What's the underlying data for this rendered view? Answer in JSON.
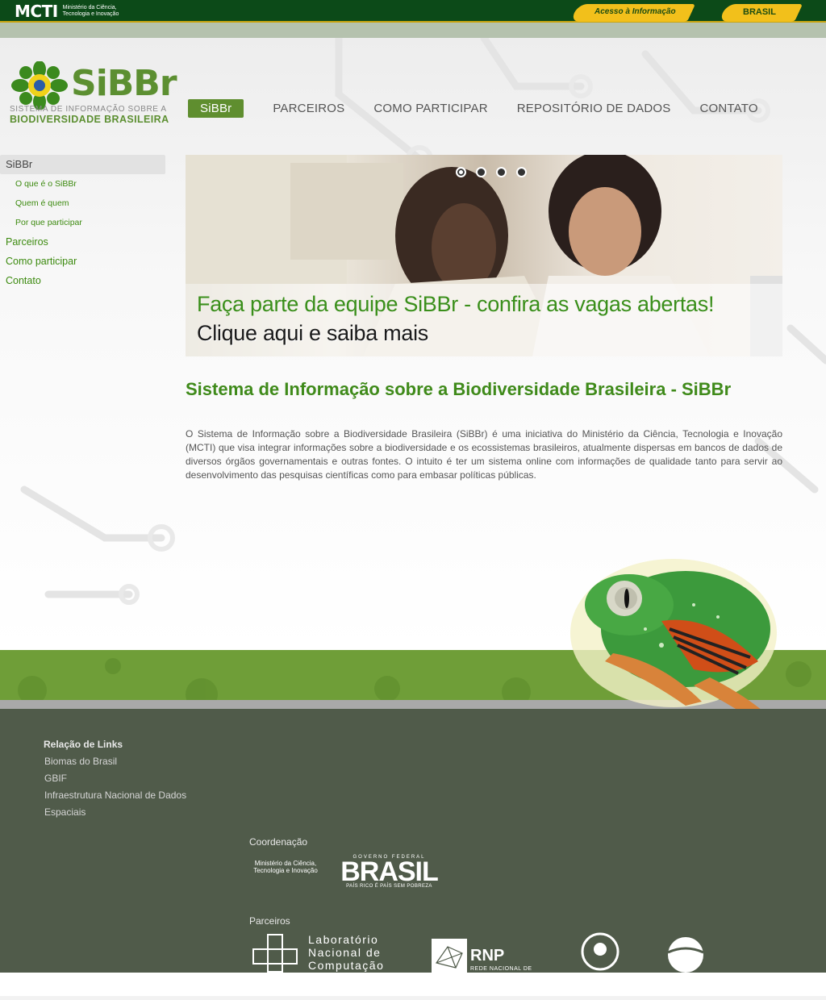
{
  "gov_bar": {
    "mcti_label": "MCTI",
    "mcti_sub": "Ministério da Ciência, Tecnologia e Inovação",
    "acesso_label": "Acesso à Informação",
    "brasil_label": "BRASIL"
  },
  "logo": {
    "name": "SiBBr",
    "line1": "SISTEMA DE INFORMAÇÃO SOBRE A",
    "line2": "BIODIVERSIDADE BRASILEIRA"
  },
  "nav": {
    "items": [
      "SiBBr",
      "PARCEIROS",
      "COMO PARTICIPAR",
      "REPOSITÓRIO DE DADOS",
      "CONTATO"
    ],
    "active_index": 0
  },
  "sidebar": {
    "head": "SiBBr",
    "sub_items": [
      "O que é o SiBBr",
      "Quem é quem",
      "Por que participar"
    ],
    "items": [
      "Parceiros",
      "Como participar",
      "Contato"
    ]
  },
  "banner": {
    "caption1": "Faça parte da equipe SiBBr - confira as vagas abertas!",
    "caption2": "Clique aqui e saiba mais",
    "slide_count": 4,
    "active_slide": 0
  },
  "main": {
    "title": "Sistema de Informação sobre a Biodiversidade Brasileira - SiBBr",
    "text": "O Sistema de Informação sobre a Biodiversidade Brasileira (SiBBr) é uma iniciativa do Ministério da Ciência, Tecnologia e Inovação (MCTI) que visa integrar informações sobre a biodiversidade e os ecossistemas brasileiros, atualmente dispersas em bancos de dados de diversos órgãos governamentais e outras fontes. O intuito é ter um sistema online com informações de qualidade tanto para servir ao desenvolvimento das pesquisas científicas como para embasar políticas públicas."
  },
  "footer": {
    "links_title": "Relação de Links",
    "links": [
      "Biomas do Brasil",
      "GBIF",
      "Infraestrutura Nacional de Dados",
      "Espaciais"
    ],
    "coord_title": "Coordenação",
    "mcti_logo_text": "Ministério da Ciência, Tecnologia e Inovação",
    "brasil_gov": "GOVERNO FEDERAL",
    "brasil_word": "BRASIL",
    "brasil_slogan": "PAÍS RICO É PAÍS SEM POBREZA",
    "parc_title": "Parceiros",
    "lnc_text": "Laboratório Nacional de Computação",
    "rnp_word": "RNP",
    "rnp_sub": "REDE NACIONAL DE"
  },
  "colors": {
    "brand_green": "#5f8e2f",
    "gov_green": "#0c4a18",
    "footer_bg": "#505b4a",
    "link_green": "#3c8a0f"
  }
}
